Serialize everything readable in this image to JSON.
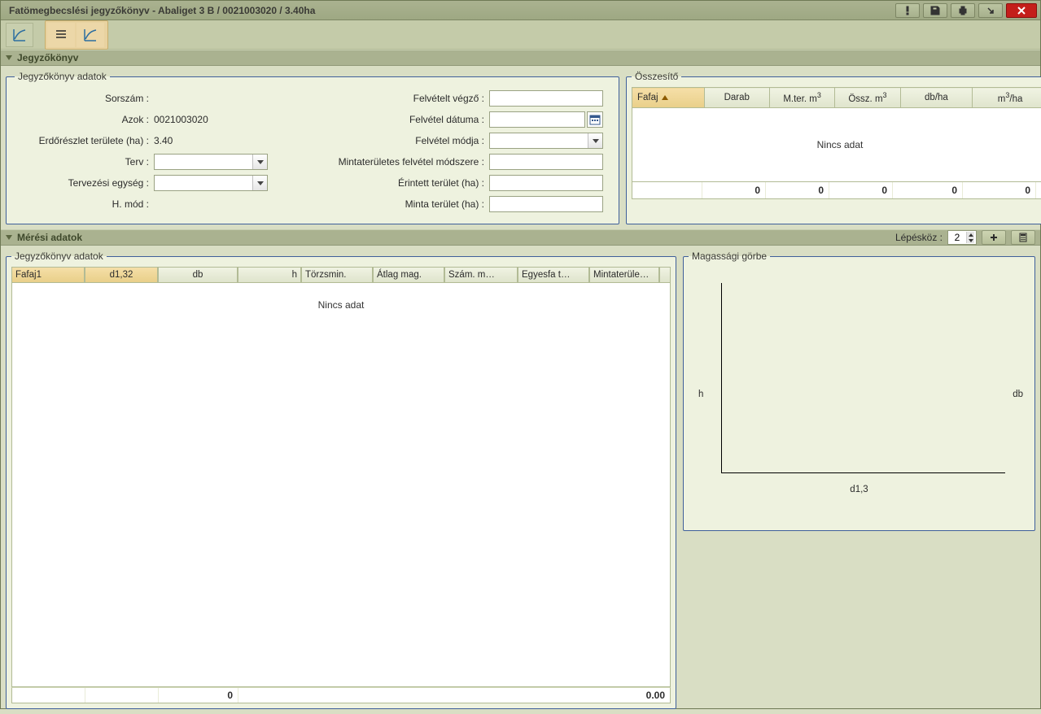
{
  "window_title": "Fatömegbecslési jegyzőkönyv - Abaliget 3 B / 0021003020 / 3.40ha",
  "sections": {
    "jegyzokonyv": "Jegyzőkönyv",
    "meresi_adatok": "Mérési adatok"
  },
  "form": {
    "legend": "Jegyzőkönyv adatok",
    "labels": {
      "sorszam": "Sorszám :",
      "azok": "Azok :",
      "erdoreszlet": "Erdőrészlet területe (ha) :",
      "terv": "Terv :",
      "tervezesi_egyseg": "Tervezési egység :",
      "hmod": "H. mód :",
      "felvetelt_vegzo": "Felvételt végző :",
      "felvetel_datuma": "Felvétel dátuma :",
      "felvetel_modja": "Felvétel módja :",
      "mintateruletes_modszer": "Mintaterületes felvétel módszere :",
      "erintett_terulet": "Érintett terület (ha) :",
      "minta_terulet": "Minta terület (ha) :"
    },
    "values": {
      "azok": "0021003020",
      "erdoreszlet": "3.40"
    }
  },
  "summary": {
    "legend": "Összesítő",
    "columns": [
      "Fafaj",
      "Darab",
      "M.ter. m",
      "Össz. m",
      "db/ha",
      "m",
      "/ha"
    ],
    "no_data": "Nincs adat",
    "footer": [
      "",
      "0",
      "0",
      "0",
      "0",
      "0",
      ""
    ]
  },
  "step": {
    "label": "Lépésköz :",
    "value": "2"
  },
  "grid": {
    "legend": "Jegyzőkönyv adatok",
    "columns": [
      "Fafaj",
      "d1,3",
      "db",
      "h",
      "Törzsmin.",
      "Átlag mag.",
      "Szám. m…",
      "Egyesfa t…",
      "Mintaterüle…"
    ],
    "sort_idx": {
      "c1": "1",
      "c2": "2"
    },
    "no_data": "Nincs adat",
    "footer_db": "0",
    "footer_last": "0.00"
  },
  "curve": {
    "legend": "Magassági görbe",
    "y_label": "h",
    "y2_label": "db",
    "x_label": "d1,3"
  },
  "chart_data": {
    "type": "scatter",
    "title": "Magassági görbe",
    "xlabel": "d1,3",
    "ylabel": "h",
    "y2label": "db",
    "series": []
  }
}
